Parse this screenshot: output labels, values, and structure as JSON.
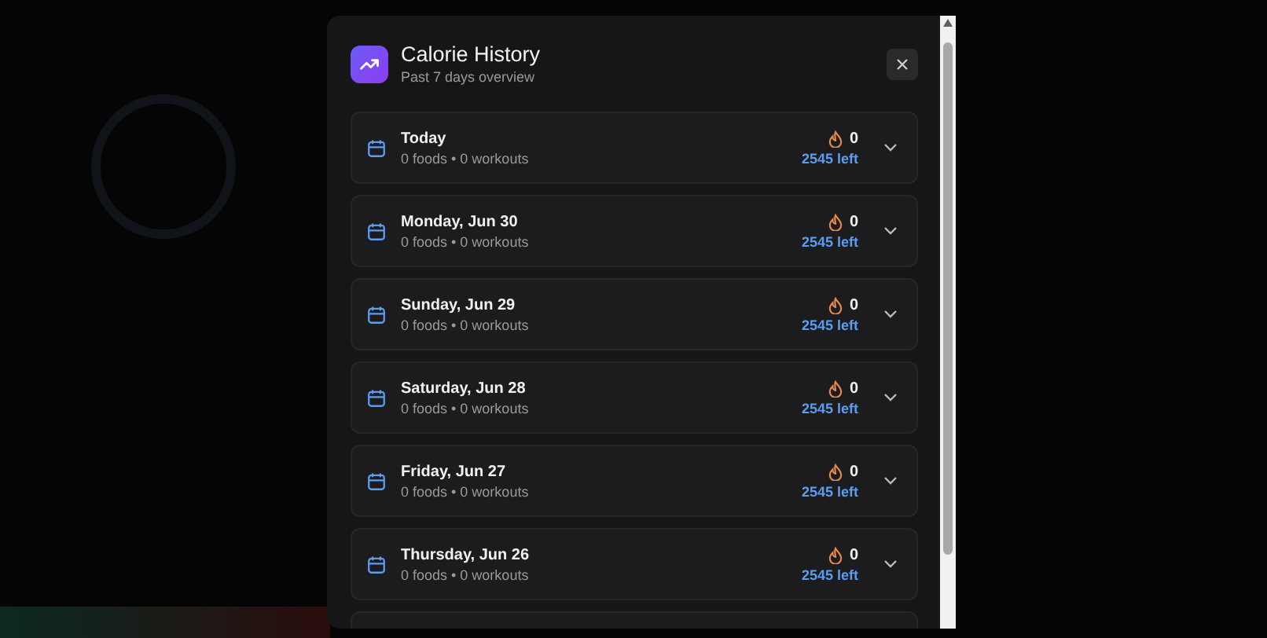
{
  "dialog": {
    "title": "Calorie History",
    "subtitle": "Past 7 days overview"
  },
  "days": [
    {
      "label": "Today",
      "summary": "0 foods • 0 workouts",
      "calories": "0",
      "remaining": "2545 left"
    },
    {
      "label": "Monday, Jun 30",
      "summary": "0 foods • 0 workouts",
      "calories": "0",
      "remaining": "2545 left"
    },
    {
      "label": "Sunday, Jun 29",
      "summary": "0 foods • 0 workouts",
      "calories": "0",
      "remaining": "2545 left"
    },
    {
      "label": "Saturday, Jun 28",
      "summary": "0 foods • 0 workouts",
      "calories": "0",
      "remaining": "2545 left"
    },
    {
      "label": "Friday, Jun 27",
      "summary": "0 foods • 0 workouts",
      "calories": "0",
      "remaining": "2545 left"
    },
    {
      "label": "Thursday, Jun 26",
      "summary": "0 foods • 0 workouts",
      "calories": "0",
      "remaining": "2545 left"
    }
  ]
}
